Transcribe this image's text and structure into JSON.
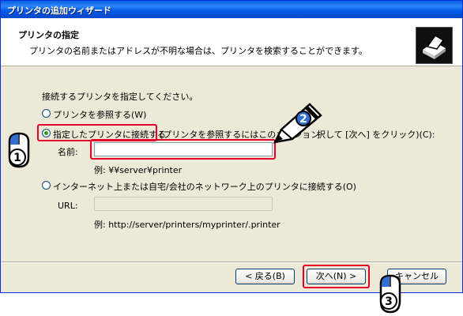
{
  "window": {
    "title": "プリンタの追加ウィザード"
  },
  "header": {
    "title": "プリンタの指定",
    "subtitle": "プリンタの名前またはアドレスが不明な場合は、プリンタを検索することができます。",
    "icon": "printer-icon"
  },
  "body": {
    "prompt": "接続するプリンタを指定してください。",
    "options": [
      {
        "label": "プリンタを参照する(W)",
        "selected": false
      },
      {
        "label": "指定したプリンタに接続する",
        "label_rest": "(プリンタを参照するにはこのオプション",
        "label_tail": "択して [次へ] をクリック)(C):",
        "selected": true
      },
      {
        "label": "インターネット上または自宅/会社のネットワーク上のプリンタに接続する(O)",
        "selected": false
      }
    ],
    "name_label": "名前:",
    "name_value": "",
    "name_example": "例: ¥¥server¥printer",
    "url_label": "URL:",
    "url_value": "",
    "url_example": "例: http://server/printers/myprinter/.printer"
  },
  "buttons": {
    "back": "< 戻る(B)",
    "next": "次へ(N) >",
    "cancel": "キャンセル"
  },
  "callouts": {
    "step1": "1",
    "step2": "2",
    "step3": "3"
  },
  "colors": {
    "highlight": "#e4002b",
    "selected_radio": "#21a121",
    "titlebar": "#0058e6"
  }
}
